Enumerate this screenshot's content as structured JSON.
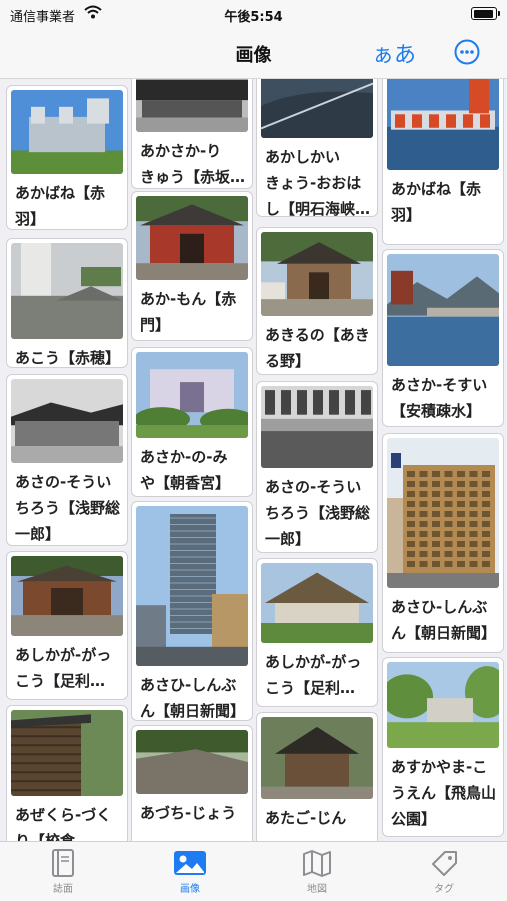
{
  "status": {
    "carrier": "通信事業者",
    "time": "午後5:54",
    "battery_level": 1.0
  },
  "nav": {
    "title": "画像",
    "font_button": "ぁあ"
  },
  "columns": [
    [
      {
        "caption": "あかばね【赤\n羽】",
        "scene": "tower-blue"
      },
      {
        "caption": "あこう【赤穂】",
        "scene": "ruins"
      },
      {
        "caption": "あさの-そうい\nちろう【浅野総\n一郎】",
        "scene": "bw-house"
      },
      {
        "caption": "あしかが-がっ\nこう【足利…",
        "scene": "gate"
      },
      {
        "caption": "あぜくら-づく\nり【校倉…",
        "scene": "storehouse"
      }
    ],
    [
      {
        "caption": "あかさか-り\nきゅう【赤坂…",
        "scene": "bw-building"
      },
      {
        "caption": "あか-もん【赤\n門】",
        "scene": "red-gate"
      },
      {
        "caption": "あさか-の-み\nや【朝香宮】",
        "scene": "villa"
      },
      {
        "caption": "あさひ-しんぶ\nん【朝日新聞】",
        "scene": "skyscraper"
      },
      {
        "caption": "あづち-じょう",
        "scene": "stone-wall"
      }
    ],
    [
      {
        "caption": "あかしかい\nきょう-おおは\nし【明石海峡…",
        "scene": "aerial"
      },
      {
        "caption": "あきるの【あき\nる野】",
        "scene": "temple-gate"
      },
      {
        "caption": "あさの-そうい\nちろう【浅野総\n一郎】",
        "scene": "bw-hall"
      },
      {
        "caption": "あしかが-がっ\nこう【足利…",
        "scene": "thatched"
      },
      {
        "caption": "あたご-じん",
        "scene": "shrine"
      }
    ],
    [
      {
        "caption": "あかばね【赤\n羽】",
        "scene": "sluice-red"
      },
      {
        "caption": "あさか-そすい\n【安積疎水】",
        "scene": "bridge"
      },
      {
        "caption": "あさひ-しんぶ\nん【朝日新聞】",
        "scene": "office"
      },
      {
        "caption": "あすかやま-こ\nうえん【飛鳥山\n公園】",
        "scene": "park"
      }
    ]
  ],
  "tabs": [
    {
      "label": "誌面",
      "icon": "book-icon",
      "active": false
    },
    {
      "label": "画像",
      "icon": "photo-icon",
      "active": true
    },
    {
      "label": "地図",
      "icon": "map-icon",
      "active": false
    },
    {
      "label": "タグ",
      "icon": "tag-icon",
      "active": false
    }
  ],
  "colors": {
    "accent": "#1f7cf0",
    "inactive": "#8e8e93"
  }
}
